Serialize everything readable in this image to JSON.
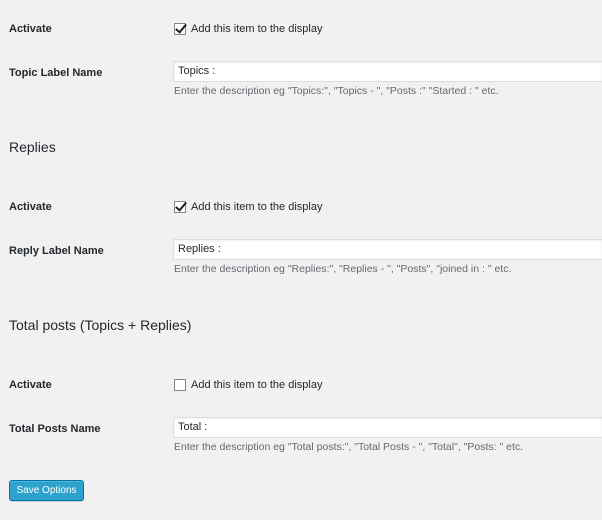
{
  "topics": {
    "activate_label": "Activate",
    "checkbox_label": "Add this item to the display",
    "checked": true,
    "name_label": "Topic Label Name",
    "input_value": "Topics :",
    "description": "Enter the description eg \"Topics:\", \"Topics - \", \"Posts :\" \"Started : \" etc."
  },
  "replies": {
    "section_title": "Replies",
    "activate_label": "Activate",
    "checkbox_label": "Add this item to the display",
    "checked": true,
    "name_label": "Reply Label Name",
    "input_value": "Replies :",
    "description": "Enter the description eg \"Replies:\", \"Replies - \", \"Posts\", \"joined in : \" etc."
  },
  "total_posts": {
    "section_title": "Total posts (Topics + Replies)",
    "activate_label": "Activate",
    "checkbox_label": "Add this item to the display",
    "checked": false,
    "name_label": "Total Posts Name",
    "input_value": "Total :",
    "description": "Enter the description eg \"Total posts:\", \"Total Posts - \", \"Total\", \"Posts: \" etc."
  },
  "save_button_label": "Save Options",
  "colors": {
    "background": "#f1f1f1",
    "button": "#2ea2cc",
    "button_border": "#0074a2",
    "description_text": "#646970"
  }
}
